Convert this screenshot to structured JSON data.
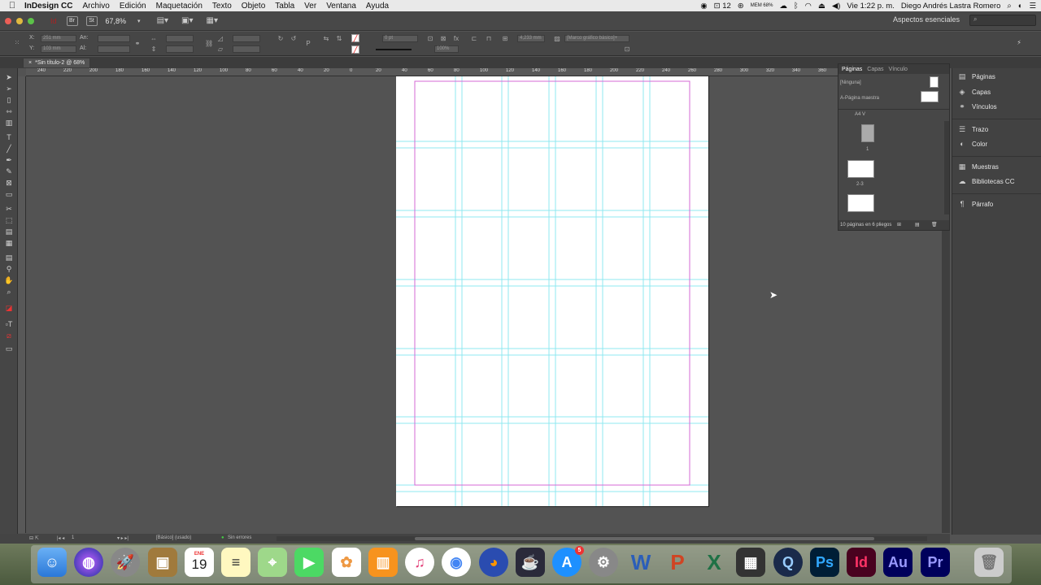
{
  "menubar": {
    "app_name": "InDesign CC",
    "items": [
      "Archivo",
      "Edición",
      "Maquetación",
      "Texto",
      "Objeto",
      "Tabla",
      "Ver",
      "Ventana",
      "Ayuda"
    ],
    "status": {
      "notifications": "12",
      "memory": "MEM 68%",
      "clock": "Vie 1:22 p. m.",
      "user": "Diego Andrés Lastra Romero"
    }
  },
  "appbar": {
    "zoom": "67,8%",
    "workspace": "Aspectos esenciales"
  },
  "control": {
    "x_label": "X:",
    "x_value": "251 mm",
    "y_label": "Y:",
    "y_value": "103 mm",
    "w_label": "An:",
    "h_label": "Al:",
    "stroke_value": "0 pt",
    "opacity_value": "100%",
    "size_value": "4,233 mm",
    "object_style": "[Marco gráfico básico]+"
  },
  "document": {
    "tab_title": "*Sin título-2 @ 68%"
  },
  "ruler": {
    "ticks": [
      "240",
      "220",
      "200",
      "180",
      "160",
      "140",
      "120",
      "100",
      "80",
      "60",
      "40",
      "20",
      "0",
      "20",
      "40",
      "60",
      "80",
      "100",
      "120",
      "140",
      "160",
      "180",
      "200",
      "220",
      "240",
      "260",
      "280",
      "300",
      "320",
      "340",
      "360",
      "380",
      "400",
      "420",
      "440"
    ]
  },
  "pages_panel": {
    "tabs": [
      "Páginas",
      "Capas",
      "Vínculo"
    ],
    "none_label": "[Ninguna]",
    "master_label": "A-Página maestra",
    "size_label": "A4 V",
    "page_labels": [
      "1",
      "2-3"
    ],
    "footer": "10 páginas en 6 pliegos"
  },
  "dock": {
    "items": [
      "Páginas",
      "Capas",
      "Vínculos",
      "Trazo",
      "Color",
      "Muestras",
      "Bibliotecas CC",
      "Párrafo"
    ]
  },
  "status": {
    "page": "1",
    "master": "[Básico] (usado)",
    "errors": "Sin errores"
  },
  "macdock": {
    "calendar_month": "ENE",
    "calendar_day": "19",
    "appstore_badge": "5"
  }
}
